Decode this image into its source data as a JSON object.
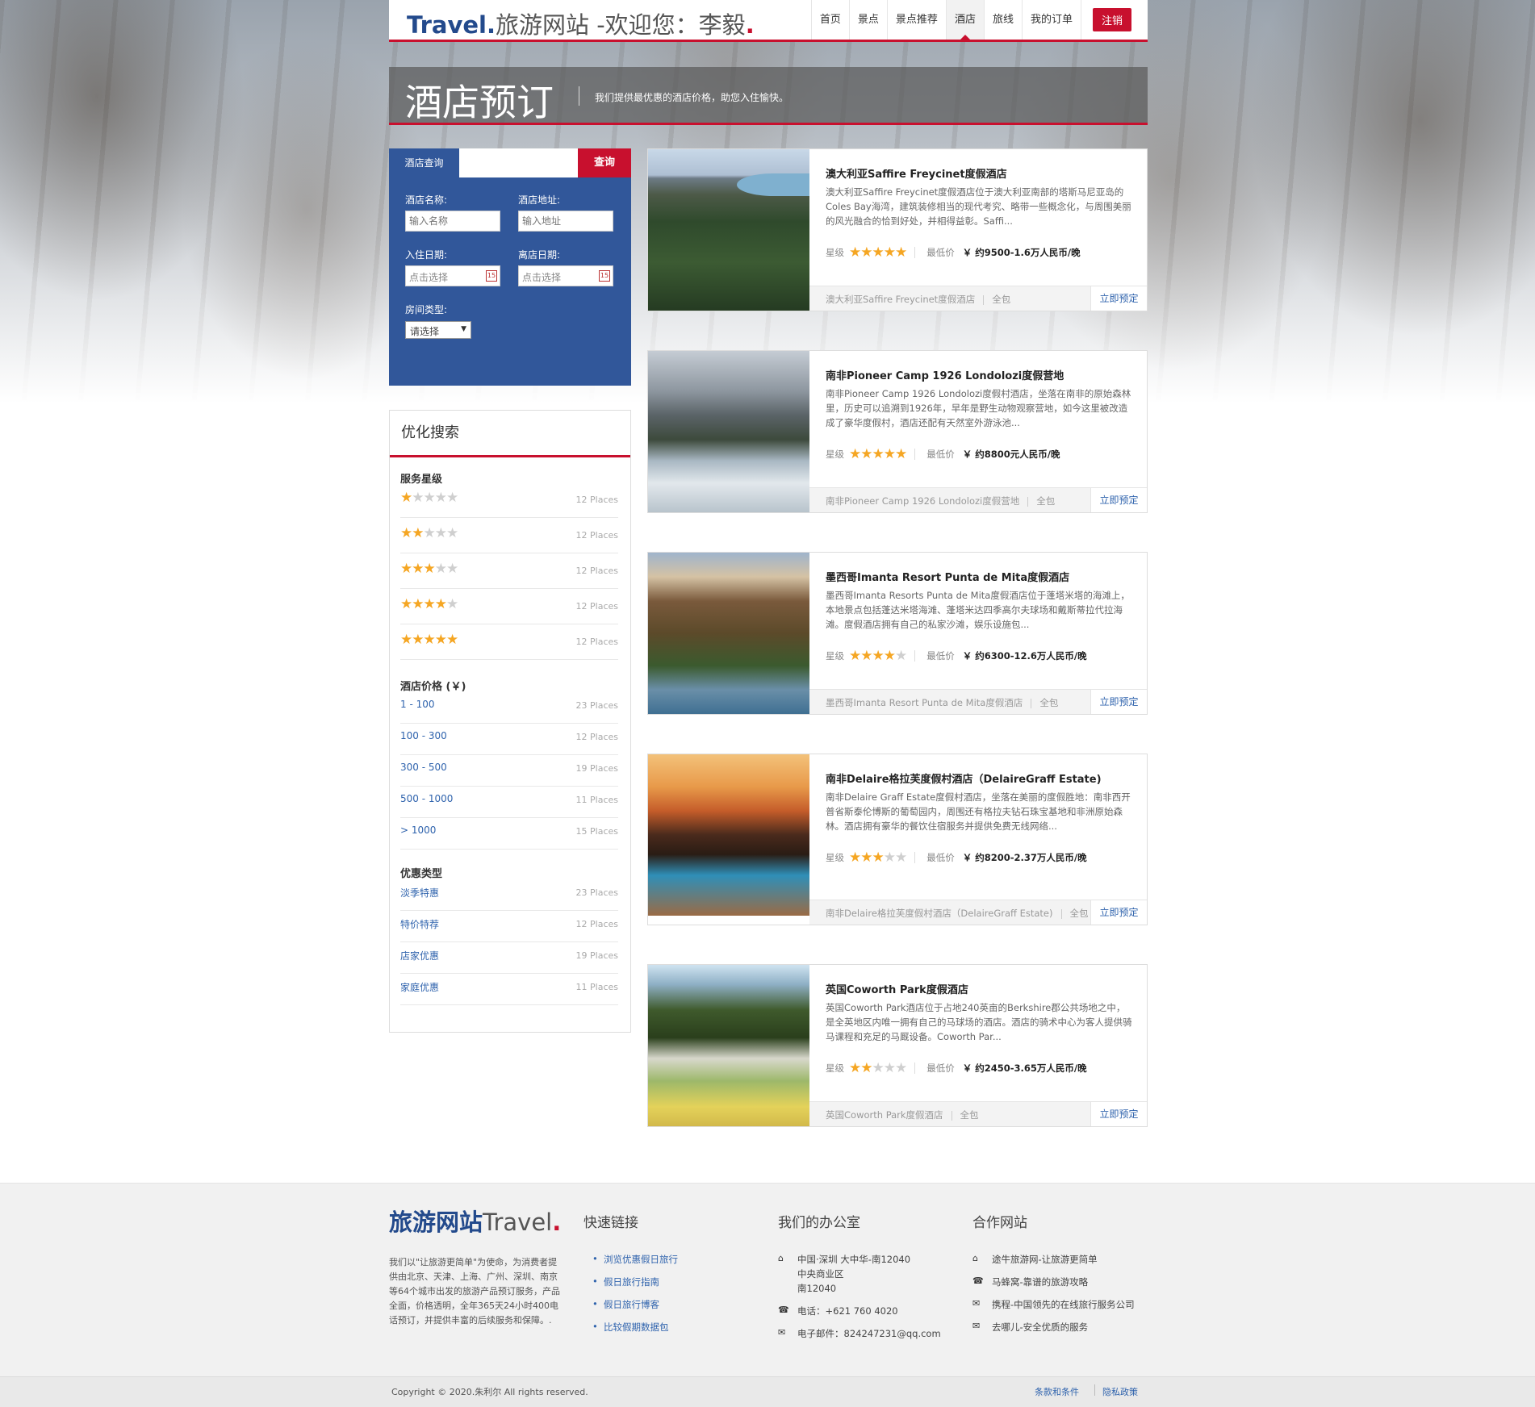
{
  "header": {
    "brand": "Travel.",
    "site_name": "旅游网站 -欢迎您：李毅",
    "dot": ".",
    "nav": [
      "首页",
      "景点",
      "景点推荐",
      "酒店",
      "旅线",
      "我的订单"
    ],
    "active_nav": "酒店",
    "logout": "注销",
    "accent_color": "#c8102e",
    "brand_color": "#234a8c"
  },
  "banner": {
    "title": "酒店预订",
    "subtitle": "我们提供最优惠的酒店价格，助您入住愉快。"
  },
  "search": {
    "tab": "酒店查询",
    "button": "查询",
    "name_label": "酒店名称:",
    "name_placeholder": "输入名称",
    "address_label": "酒店地址:",
    "address_placeholder": "输入地址",
    "checkin_label": "入住日期:",
    "checkin_placeholder": "点击选择",
    "checkout_label": "离店日期:",
    "checkout_placeholder": "点击选择",
    "room_label": "房间类型:",
    "room_value": "请选择",
    "panel_color": "#31579a"
  },
  "filters": {
    "title": "优化搜索",
    "star_title": "服务星级",
    "star_rows": [
      {
        "stars": 1,
        "count": "12 Places"
      },
      {
        "stars": 2,
        "count": "12 Places"
      },
      {
        "stars": 3,
        "count": "12 Places"
      },
      {
        "stars": 4,
        "count": "12 Places"
      },
      {
        "stars": 5,
        "count": "12 Places"
      }
    ],
    "price_title": "酒店价格 (￥)",
    "price_rows": [
      {
        "label": "1 - 100",
        "count": "23 Places"
      },
      {
        "label": "100 - 300",
        "count": "12 Places"
      },
      {
        "label": "300 - 500",
        "count": "19 Places"
      },
      {
        "label": "500 - 1000",
        "count": "11 Places"
      },
      {
        "label": "> 1000",
        "count": "15 Places"
      }
    ],
    "deal_title": "优惠类型",
    "deal_rows": [
      {
        "label": "淡季特惠",
        "count": "23 Places"
      },
      {
        "label": "特价特荐",
        "count": "12 Places"
      },
      {
        "label": "店家优惠",
        "count": "19 Places"
      },
      {
        "label": "家庭优惠",
        "count": "11 Places"
      }
    ]
  },
  "hotels": [
    {
      "name": "澳大利亚Saffire Freycinet度假酒店",
      "desc": "澳大利亚Saffire Freycinet度假酒店位于澳大利亚南部的塔斯马尼亚岛的Coles Bay海湾，建筑装修相当的现代考究、略带一些概念化，与周围美丽的风光融合的恰到好处，并相得益彰。Saffi...",
      "star_label": "星级",
      "stars": 5,
      "price_label": "最低价",
      "price": "￥ 约9500-1.6万人民币/晚",
      "location": "澳大利亚Saffire Freycinet度假酒店",
      "package": "全包",
      "book": "立即预定"
    },
    {
      "name": "南非Pioneer Camp 1926 Londolozi度假营地",
      "desc": "南非Pioneer Camp 1926 Londolozi度假村酒店，坐落在南非的原始森林里，历史可以追溯到1926年，早年是野生动物观察营地，如今这里被改造成了豪华度假村，酒店还配有天然室外游泳池...",
      "star_label": "星级",
      "stars": 5,
      "price_label": "最低价",
      "price": "￥ 约8800元人民币/晚",
      "location": "南非Pioneer Camp 1926 Londolozi度假营地",
      "package": "全包",
      "book": "立即预定"
    },
    {
      "name": "墨西哥Imanta Resort Punta de Mita度假酒店",
      "desc": "墨西哥Imanta Resorts Punta de Mita度假酒店位于蓬塔米塔的海滩上，本地景点包括蓬达米塔海滩、蓬塔米达四季高尔夫球场和戴斯蒂拉代拉海滩。度假酒店拥有自己的私家沙滩，娱乐设施包...",
      "star_label": "星级",
      "stars": 4,
      "price_label": "最低价",
      "price": "￥ 约6300-12.6万人民币/晚",
      "location": "墨西哥Imanta Resort Punta de Mita度假酒店",
      "package": "全包",
      "book": "立即预定"
    },
    {
      "name": "南非Delaire格拉芙度假村酒店（DelaireGraff Estate)",
      "desc": "南非Delaire Graff Estate度假村酒店，坐落在美丽的度假胜地：南非西开普省斯泰伦博斯的葡萄园内，周围还有格拉夫钻石珠宝基地和非洲原始森林。酒店拥有豪华的餐饮住宿服务并提供免费无线网络...",
      "star_label": "星级",
      "stars": 3,
      "price_label": "最低价",
      "price": "￥ 约8200-2.37万人民币/晚",
      "location": "南非Delaire格拉芙度假村酒店（DelaireGraff Estate)",
      "package": "全包",
      "book": "立即预定"
    },
    {
      "name": "英国Coworth Park度假酒店",
      "desc": "英国Coworth Park酒店位于占地240英亩的Berkshire郡公共场地之中，是全英地区内唯一拥有自己的马球场的酒店。酒店的骑术中心为客人提供骑马课程和充足的马厩设备。Coworth Par...",
      "star_label": "星级",
      "stars": 2,
      "price_label": "最低价",
      "price": "￥ 约2450-3.65万人民币/晚",
      "location": "英国Coworth Park度假酒店",
      "package": "全包",
      "book": "立即预定"
    }
  ],
  "footer": {
    "logo_cn": "旅游网站",
    "logo_en": "Travel",
    "logo_dot": ".",
    "about": "我们以\"让旅游更简单\"为使命，为消费者提供由北京、天津、上海、广州、深圳、南京等64个城市出发的旅游产品预订服务，产品全面，价格透明，全年365天24小时400电话预订，并提供丰富的后续服务和保障。.",
    "links_title": "快速链接",
    "links": [
      "浏览优惠假日旅行",
      "假日旅行指南",
      "假日旅行博客",
      "比较假期数据包"
    ],
    "office_title": "我们的办公室",
    "office_address_1": "中国·深圳 大中华-南12040",
    "office_address_2": "中央商业区",
    "office_address_3": "南12040",
    "office_phone": "电话：+621 760 4020",
    "office_email": "电子邮件：824247231@qq.com",
    "partners_title": "合作网站",
    "partners": [
      "途牛旅游网-让旅游更简单",
      "马蜂窝-靠谱的旅游攻略",
      "携程-中国领先的在线旅行服务公司",
      "去哪儿-安全优质的服务"
    ],
    "copyright": "Copyright © 2020.朱利尔 All rights reserved.",
    "terms": "条款和条件",
    "privacy": "隐私政策"
  }
}
